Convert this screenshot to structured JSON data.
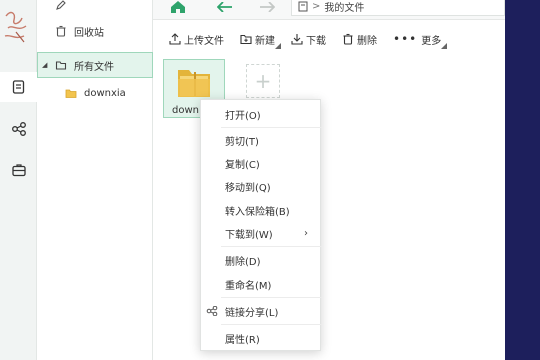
{
  "sidebar": {
    "items": [
      {
        "label": "",
        "icon": "pencil-icon"
      },
      {
        "label": "回收站",
        "icon": "trash-icon"
      },
      {
        "label": "所有文件",
        "icon": "folder-icon"
      },
      {
        "label": "downxia",
        "icon": "folder-icon"
      }
    ]
  },
  "rail": {
    "icons": [
      "avatar-sketch",
      "files-icon",
      "share-icon",
      "briefcase-icon"
    ]
  },
  "nav": {
    "path_root": "我的文件",
    "sep": ">"
  },
  "toolbar": {
    "upload": "上传文件",
    "new": "新建",
    "download": "下载",
    "delete": "删除",
    "more": "更多"
  },
  "files": [
    {
      "name": "down",
      "type": "folder"
    }
  ],
  "context_menu": {
    "items": [
      {
        "label": "打开(O)"
      },
      {
        "label": "剪切(T)"
      },
      {
        "label": "复制(C)"
      },
      {
        "label": "移动到(Q)"
      },
      {
        "label": "转入保险箱(B)"
      },
      {
        "label": "下载到(W)",
        "arrow": "›"
      },
      {
        "label": "删除(D)"
      },
      {
        "label": "重命名(M)"
      },
      {
        "label": "链接分享(L)"
      },
      {
        "label": "属性(R)"
      }
    ]
  },
  "colors": {
    "accent_green": "#2ea36b",
    "selected_bg": "#e3f4ec",
    "selected_border": "#9fd7bb",
    "dark_edge": "#1d1f5c"
  }
}
